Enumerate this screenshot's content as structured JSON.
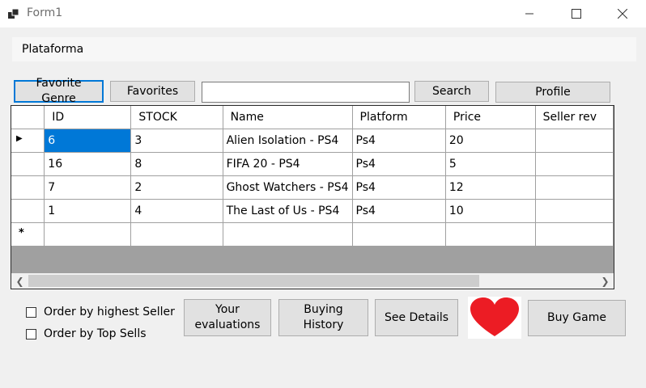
{
  "window": {
    "title": "Form1"
  },
  "menu": {
    "items": [
      {
        "label": "Plataforma"
      }
    ]
  },
  "toolbar": {
    "favorite_genre": "Favorite Genre",
    "favorites": "Favorites",
    "search_value": "",
    "search": "Search",
    "profile": "Profile"
  },
  "grid": {
    "columns": [
      "ID",
      "STOCK",
      "Name",
      "Platform",
      "Price",
      "Seller rev"
    ],
    "rows": [
      [
        "6",
        "3",
        "Alien Isolation - PS4",
        "Ps4",
        "20",
        ""
      ],
      [
        "16",
        "8",
        "FIFA 20 - PS4",
        "Ps4",
        "5",
        ""
      ],
      [
        "7",
        "2",
        "Ghost Watchers - PS4",
        "Ps4",
        "12",
        ""
      ],
      [
        "1",
        "4",
        "The Last of Us - PS4",
        "Ps4",
        "10",
        ""
      ]
    ],
    "current_row_marker": "▶",
    "new_row_marker": "*"
  },
  "options": {
    "order_seller": "Order by highest Seller",
    "order_sells": "Order by Top Sells"
  },
  "actions": {
    "evaluations": "Your evaluations",
    "history": "Buying History",
    "details": "See Details",
    "buy": "Buy  Game"
  },
  "colors": {
    "accent": "#0078d7",
    "heart": "#ec1c24"
  }
}
